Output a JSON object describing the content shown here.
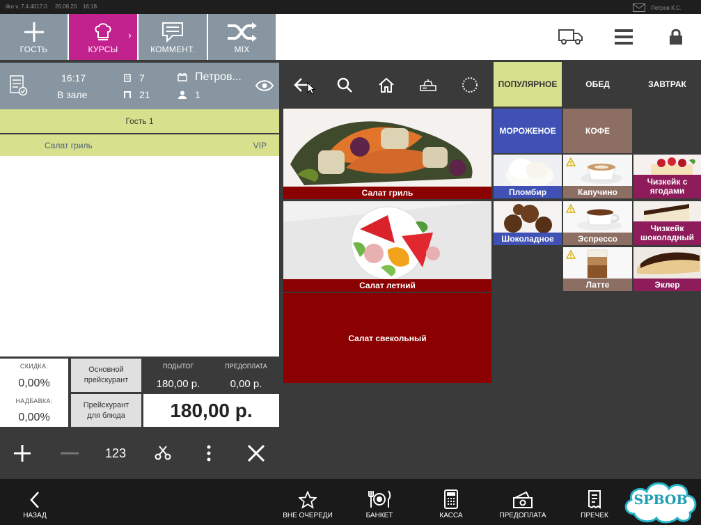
{
  "status": {
    "version": "iiko  v. 7.4.4017.0",
    "date": "26.08.20",
    "time": "16:18",
    "user": "Петров К.С."
  },
  "toolbar": {
    "guest": "ГОСТЬ",
    "courses": "КУРСЫ",
    "comment": "КОММЕНТ.",
    "mix": "MIX"
  },
  "order": {
    "time": "16:17",
    "location": "В зале",
    "order_number": "7",
    "table_number": "21",
    "waiter": "Петров...",
    "guests": "1",
    "guest_label": "Гость 1",
    "items": [
      {
        "name": "Салат гриль",
        "tag": "VIP"
      }
    ]
  },
  "totals": {
    "discount_label": "СКИДКА:",
    "discount_value": "0,00%",
    "surcharge_label": "НАДБАВКА:",
    "surcharge_value": "0,00%",
    "main_pricelist": "Основной прейскурант",
    "dish_pricelist": "Прейскурант для блюда",
    "subtotal_label": "ПОДЫТОГ",
    "subtotal_value": "180,00 р.",
    "prepay_label": "ПРЕДОПЛАТА",
    "prepay_value": "0,00 р.",
    "total_value": "180,00 р."
  },
  "actions": {
    "numpad": "123"
  },
  "categories": [
    {
      "label": "ПОПУЛЯРНОЕ",
      "color": "#d7e08d",
      "text": "#333333"
    },
    {
      "label": "ОБЕД",
      "color": "#3a3a3a",
      "text": "#ffffff"
    },
    {
      "label": "ЗАВТРАК",
      "color": "#3a3a3a",
      "text": "#ffffff"
    },
    {
      "label": "МОРОЖЕНОЕ",
      "color": "#3f51b5",
      "text": "#ffffff"
    },
    {
      "label": "КОФЕ",
      "color": "#8d6e63",
      "text": "#ffffff"
    }
  ],
  "products": {
    "salad_grill": "Салат гриль",
    "salad_summer": "Салат летний",
    "salad_beet": "Салат свекольный",
    "plombir": "Пломбир",
    "cappuccino": "Капучино",
    "cheesecake_berries": "Чизкейк с ягодами",
    "chocolate": "Шоколадное",
    "espresso": "Эспрессо",
    "cheesecake_choc": "Чизкейк шоколадный",
    "latte": "Латте",
    "eclair": "Эклер"
  },
  "bottom": {
    "back": "НАЗАД",
    "out_of_turn": "ВНЕ ОЧЕРЕДИ",
    "banquet": "БАНКЕТ",
    "cashier": "КАССА",
    "prepayment": "ПРЕДОПЛАТА",
    "precheck": "ПРЕЧЕК"
  },
  "watermark": {
    "text": "SPBOB"
  },
  "colors": {
    "accent": "#c2228e",
    "header": "#8796a0",
    "guest_bar": "#d7e08d",
    "salad": "#8b0000",
    "icecream": "#3f51b5",
    "coffee": "#8d6e63",
    "dessert": "#8e1b5a"
  }
}
